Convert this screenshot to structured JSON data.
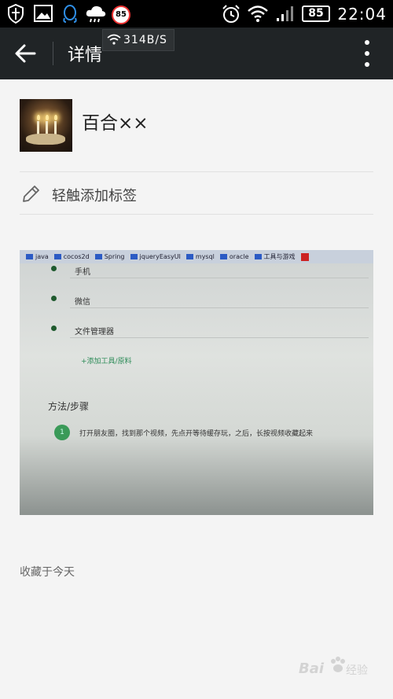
{
  "status_bar": {
    "notification_badge": "85",
    "battery": "85",
    "time": "22:04"
  },
  "app_bar": {
    "title": "详情",
    "net_speed": "314B/S"
  },
  "user": {
    "name": "百合××"
  },
  "tag": {
    "label": "轻触添加标签"
  },
  "photo": {
    "bookmarks": [
      "java",
      "cocos2d",
      "Spring",
      "jqueryEasyUI",
      "mysql",
      "oracle",
      "工具与游戏"
    ],
    "list_items": [
      "手机",
      "微信",
      "文件管理器"
    ],
    "add_tool": "+添加工具/原料",
    "method_heading": "方法/步骤",
    "step_number": "1",
    "step_text": "打开朋友圈，找到那个视频，先点开等待缓存玩，之后，长按视频收藏起来"
  },
  "footer": {
    "collected_date": "收藏于今天",
    "watermark": "Bai",
    "watermark_sub": "经验"
  }
}
